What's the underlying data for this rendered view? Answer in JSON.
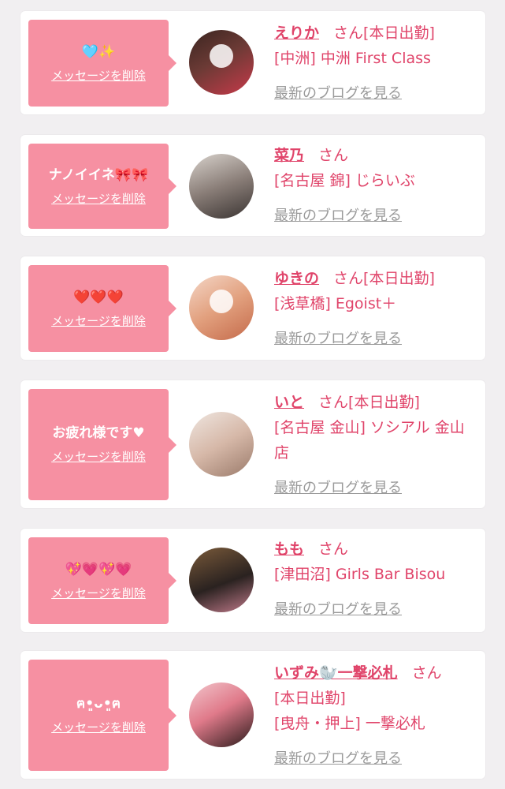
{
  "colors": {
    "accent": "#e0446a",
    "bubble": "#f690a2",
    "muted": "#9a9a9a"
  },
  "common": {
    "san": "さん",
    "delete_label": "メッセージを削除",
    "blog_label": "最新のブログを見る"
  },
  "entries": [
    {
      "message": "🩵✨",
      "name": "えりか",
      "badge": "[本日出勤]",
      "shop": "[中洲] 中洲 First Class"
    },
    {
      "message": "ナノイイネ🎀🎀",
      "name": "菜乃",
      "badge": "",
      "shop": "[名古屋 錦] じらいぶ"
    },
    {
      "message": "❤️❤️❤️",
      "name": "ゆきの",
      "badge": "[本日出勤]",
      "shop": "[浅草橋] Egoist＋"
    },
    {
      "message": "お疲れ様です♥",
      "name": "いと",
      "badge": "[本日出勤]",
      "shop": "[名古屋 金山] ソシアル 金山店"
    },
    {
      "message": "💖💗💖💗",
      "name": "もも",
      "badge": "",
      "shop": "[津田沼] Girls Bar Bisou"
    },
    {
      "message": "ฅ•͈ᴗ•͈ฅ",
      "name": "いずみ🦭一撃必札",
      "badge": "[本日出勤]",
      "shop": "[曳舟・押上] 一撃必札"
    }
  ]
}
